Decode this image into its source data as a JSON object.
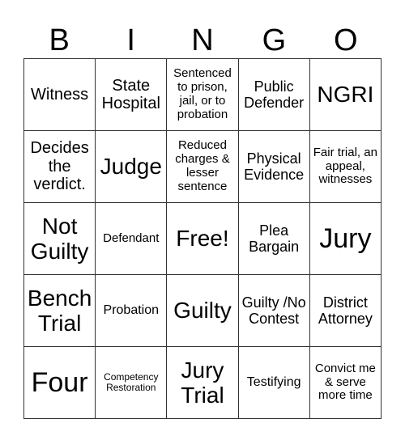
{
  "header": {
    "letters": [
      "B",
      "I",
      "N",
      "G",
      "O"
    ]
  },
  "card": {
    "rows": [
      [
        "Witness",
        "State Hospital",
        "Sentenced to prison, jail, or to probation",
        "Public Defender",
        "NGRI"
      ],
      [
        "Decides the verdict.",
        "Judge",
        "Reduced charges & lesser sentence",
        "Physical Evidence",
        "Fair trial, an appeal, witnesses"
      ],
      [
        "Not Guilty",
        "Defendant",
        "Free!",
        "Plea Bargain",
        "Jury"
      ],
      [
        "Bench Trial",
        "Probation",
        "Guilty",
        "Guilty /No Contest",
        "District Attorney"
      ],
      [
        "Four",
        "Competency Restoration",
        "Jury Trial",
        "Testifying",
        "Convict me & serve more time"
      ]
    ],
    "free_space": "Free!",
    "line_color": "#333333",
    "background": "#ffffff"
  }
}
